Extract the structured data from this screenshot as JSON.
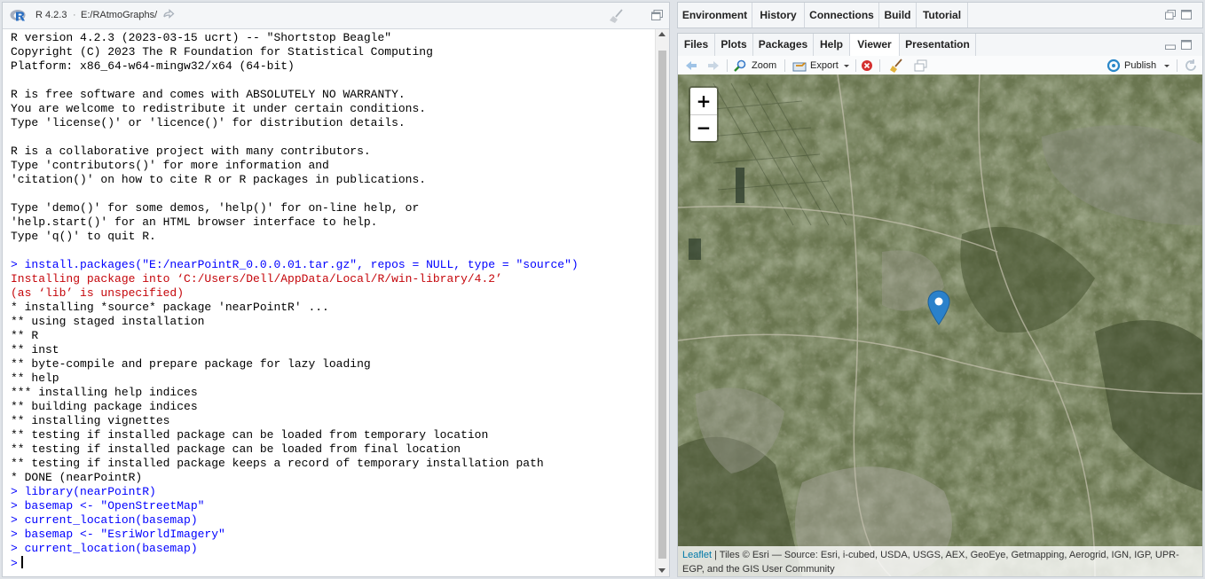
{
  "console": {
    "version": "R 4.2.3",
    "separator": "·",
    "path": "E:/RAtmoGraphs/",
    "lines": [
      {
        "text": "R version 4.2.3 (2023-03-15 ucrt) -- \"Shortstop Beagle\"",
        "style": "normal"
      },
      {
        "text": "Copyright (C) 2023 The R Foundation for Statistical Computing",
        "style": "normal"
      },
      {
        "text": "Platform: x86_64-w64-mingw32/x64 (64-bit)",
        "style": "normal"
      },
      {
        "text": "",
        "style": "normal"
      },
      {
        "text": "R is free software and comes with ABSOLUTELY NO WARRANTY.",
        "style": "normal"
      },
      {
        "text": "You are welcome to redistribute it under certain conditions.",
        "style": "normal"
      },
      {
        "text": "Type 'license()' or 'licence()' for distribution details.",
        "style": "normal"
      },
      {
        "text": "",
        "style": "normal"
      },
      {
        "text": "R is a collaborative project with many contributors.",
        "style": "normal"
      },
      {
        "text": "Type 'contributors()' for more information and",
        "style": "normal"
      },
      {
        "text": "'citation()' on how to cite R or R packages in publications.",
        "style": "normal"
      },
      {
        "text": "",
        "style": "normal"
      },
      {
        "text": "Type 'demo()' for some demos, 'help()' for on-line help, or",
        "style": "normal"
      },
      {
        "text": "'help.start()' for an HTML browser interface to help.",
        "style": "normal"
      },
      {
        "text": "Type 'q()' to quit R.",
        "style": "normal"
      },
      {
        "text": "",
        "style": "normal"
      },
      {
        "text": "> install.packages(\"E:/nearPointR_0.0.0.01.tar.gz\", repos = NULL, type = \"source\")",
        "style": "input"
      },
      {
        "text": "Installing package into ‘C:/Users/Dell/AppData/Local/R/win-library/4.2’",
        "style": "error"
      },
      {
        "text": "(as ‘lib’ is unspecified)",
        "style": "error"
      },
      {
        "text": "* installing *source* package 'nearPointR' ...",
        "style": "normal"
      },
      {
        "text": "** using staged installation",
        "style": "normal"
      },
      {
        "text": "** R",
        "style": "normal"
      },
      {
        "text": "** inst",
        "style": "normal"
      },
      {
        "text": "** byte-compile and prepare package for lazy loading",
        "style": "normal"
      },
      {
        "text": "** help",
        "style": "normal"
      },
      {
        "text": "*** installing help indices",
        "style": "normal"
      },
      {
        "text": "** building package indices",
        "style": "normal"
      },
      {
        "text": "** installing vignettes",
        "style": "normal"
      },
      {
        "text": "** testing if installed package can be loaded from temporary location",
        "style": "normal"
      },
      {
        "text": "** testing if installed package can be loaded from final location",
        "style": "normal"
      },
      {
        "text": "** testing if installed package keeps a record of temporary installation path",
        "style": "normal"
      },
      {
        "text": "* DONE (nearPointR)",
        "style": "normal"
      },
      {
        "text": "> library(nearPointR)",
        "style": "input"
      },
      {
        "text": "> basemap <- \"OpenStreetMap\"",
        "style": "input"
      },
      {
        "text": "> current_location(basemap)",
        "style": "input"
      },
      {
        "text": "> basemap <- \"EsriWorldImagery\"",
        "style": "input"
      },
      {
        "text": "> current_location(basemap)",
        "style": "input"
      }
    ],
    "prompt": ">"
  },
  "env_tabs": [
    "Environment",
    "History",
    "Connections",
    "Build",
    "Tutorial"
  ],
  "viewer_tabs": [
    "Files",
    "Plots",
    "Packages",
    "Help",
    "Viewer",
    "Presentation"
  ],
  "active_viewer_tab": "Viewer",
  "toolbar": {
    "zoom_label": "Zoom",
    "export_label": "Export",
    "publish_label": "Publish"
  },
  "map": {
    "zoom_in": "+",
    "zoom_out": "−",
    "attribution_link": "Leaflet",
    "attribution_text": " | Tiles © Esri — Source: Esri, i-cubed, USDA, USGS, AEX, GeoEye, Getmapping, Aerogrid, IGN, IGP, UPR-EGP, and the GIS User Community"
  },
  "colors": {
    "input": "#0000ff",
    "error": "#c5060b",
    "marker": "#2a81cb",
    "link": "#0078a8"
  }
}
